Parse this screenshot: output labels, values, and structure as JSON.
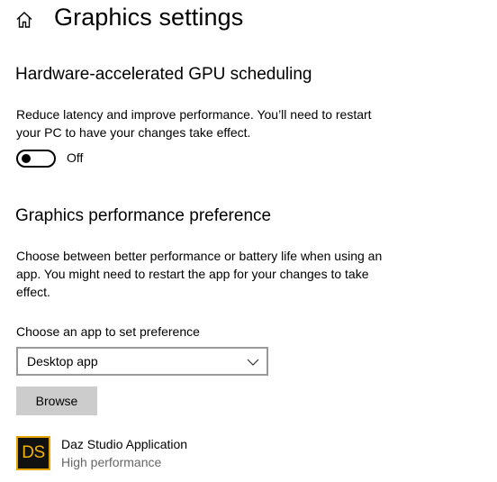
{
  "header": {
    "title": "Graphics settings",
    "home_icon": "home-icon"
  },
  "gpu_scheduling": {
    "title": "Hardware-accelerated GPU scheduling",
    "description_line1": "Reduce latency and improve performance. You’ll need to restart",
    "description_line2": "your PC to have your changes take effect.",
    "toggle_state": "Off"
  },
  "performance_preference": {
    "title": "Graphics performance preference",
    "description_line1": "Choose between better performance or battery life when using an",
    "description_line2": "app. You might need to restart the app for your changes to take",
    "description_line3": "effect.",
    "choose_label": "Choose an app to set preference",
    "selected_app_type": "Desktop app",
    "browse_label": "Browse"
  },
  "apps": [
    {
      "icon_text": "DS",
      "name": "Daz Studio Application",
      "preference": "High performance"
    }
  ],
  "colors": {
    "accent_icon_border": "#e5a400",
    "icon_text": "#f2b400",
    "button_bg": "#cccccc",
    "secondary_text": "#666666"
  }
}
